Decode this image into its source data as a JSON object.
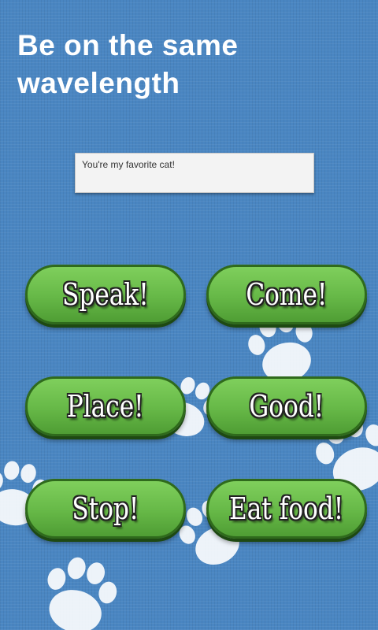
{
  "header": {
    "title": "Be on the same wavelength"
  },
  "message": {
    "text": "You're my favorite cat!"
  },
  "commands": {
    "speak": "Speak!",
    "come": "Come!",
    "place": "Place!",
    "good": "Good!",
    "stop": "Stop!",
    "eat_food": "Eat food!"
  },
  "colors": {
    "background": "#4a86c2",
    "button_green": "#66b847",
    "button_border": "#2f6a1c",
    "paw": "#ffffff"
  },
  "icons": {
    "background_decoration": "paw-print-icon"
  }
}
